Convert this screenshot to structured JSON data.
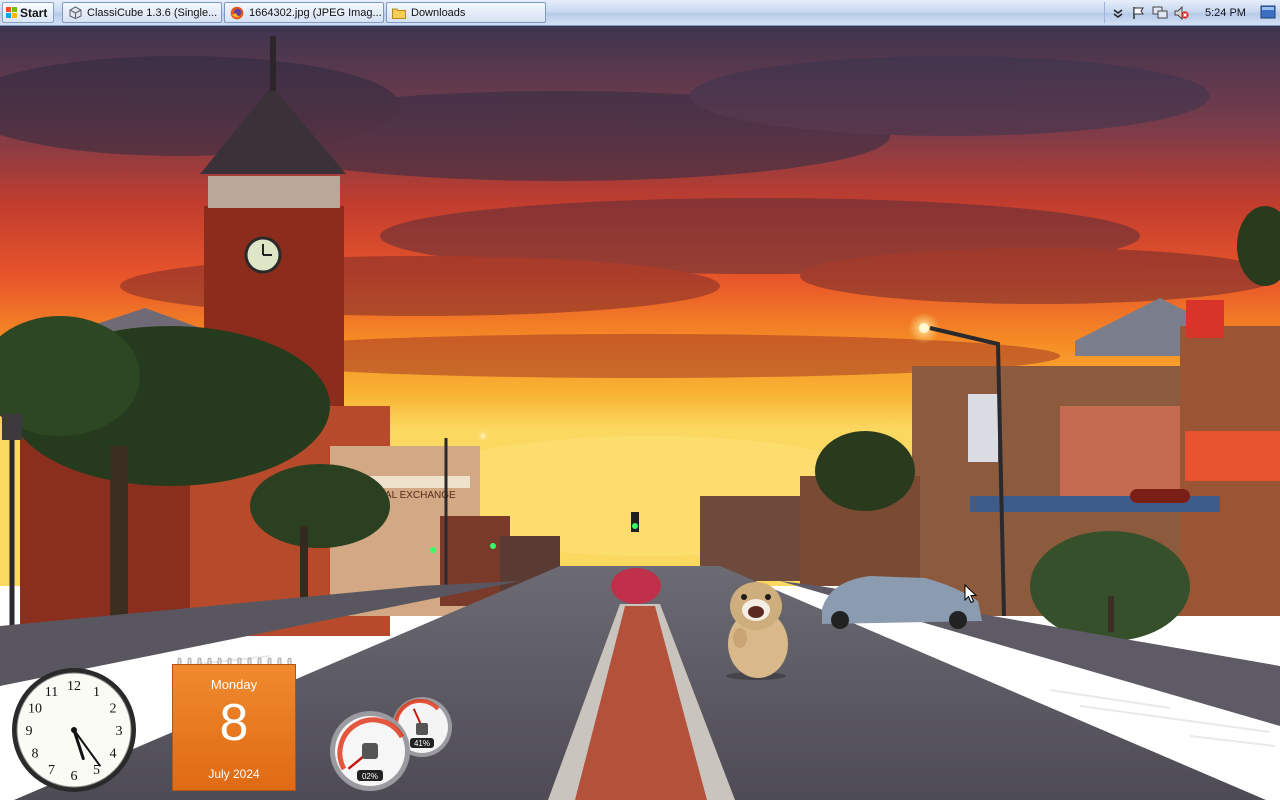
{
  "taskbar": {
    "start_label": "Start",
    "tasks": [
      {
        "label": "ClassiCube 1.3.6 (Single...",
        "icon": "classicube-icon"
      },
      {
        "label": "1664302.jpg (JPEG Imag...",
        "icon": "firefox-icon"
      },
      {
        "label": "Downloads",
        "icon": "folder-icon"
      }
    ],
    "tray": {
      "icons": [
        "chevron-down-icon",
        "flag-icon",
        "network-icon",
        "volume-muted-icon"
      ],
      "time": "5:24 PM"
    }
  },
  "gadgets": {
    "clock": {
      "hour": 5,
      "minute": 24
    },
    "calendar": {
      "weekday": "Monday",
      "day": "8",
      "month_year": "July 2024"
    },
    "cpu_meter": {
      "cpu_percent": "02%",
      "memory_percent": "41%",
      "cpu_value": 2,
      "memory_value": 41
    }
  },
  "wallpaper": {
    "sign_text": "ROYAL EXCHANGE"
  },
  "colors": {
    "calendar_orange": "#e8761c",
    "sky_red": "#d9401e",
    "sky_orange": "#f5a21f",
    "taskbar_blue": "#c9d9f0"
  }
}
